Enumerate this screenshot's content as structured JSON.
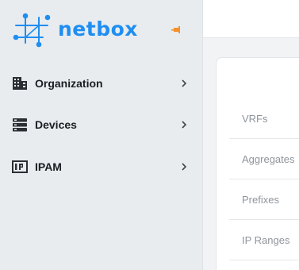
{
  "brand": {
    "name": "netbox",
    "color": "#1f8ef1",
    "pin_color": "#f5902a"
  },
  "sidebar": {
    "items": [
      {
        "label": "Organization",
        "icon": "building-icon"
      },
      {
        "label": "Devices",
        "icon": "server-icon"
      },
      {
        "label": "IPAM",
        "icon": "ip-address-icon"
      }
    ]
  },
  "main": {
    "ipam_links": [
      {
        "label": "VRFs"
      },
      {
        "label": "Aggregates"
      },
      {
        "label": "Prefixes"
      },
      {
        "label": "IP Ranges"
      }
    ]
  }
}
